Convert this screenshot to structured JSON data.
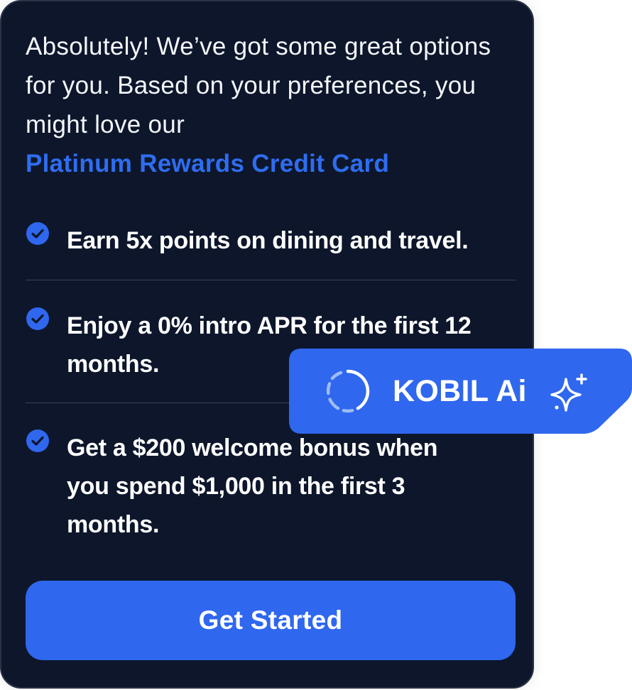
{
  "message": {
    "intro_text": "Absolutely! We’ve got some great options for you. Based on your preferences, you might love our",
    "highlight": "Platinum Rewards Credit Card"
  },
  "features": [
    {
      "text": "Earn 5x points on dining and travel."
    },
    {
      "text": "Enjoy a 0% intro APR for the first 12 months."
    },
    {
      "text": "Get a $200 welcome bonus when you spend $1,000 in the first 3 months."
    }
  ],
  "cta": {
    "label": "Get Started"
  },
  "assistant_badge": {
    "label": "KOBIL Ai"
  },
  "icons": {
    "feature": "check-circle-icon",
    "badge_left": "loading-spinner-icon",
    "badge_right": "sparkle-icon"
  },
  "colors": {
    "card_background": "#0d162b",
    "accent": "#2f67ee",
    "highlight_text": "#2e6df0",
    "text": "#ffffff"
  }
}
